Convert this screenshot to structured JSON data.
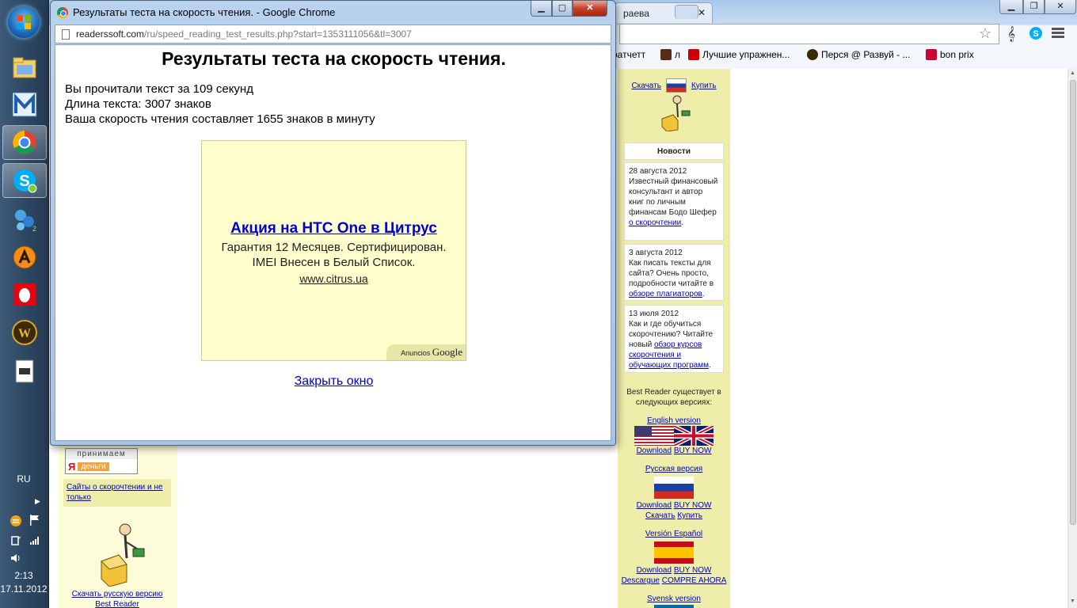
{
  "taskbar": {
    "icons": [
      "start-button",
      "file-manager-icon",
      "m-app-icon",
      "chrome-icon",
      "skype-icon",
      "molecule-app-icon",
      "aimp-icon",
      "mts-icon",
      "warcraft-icon",
      "document-icon"
    ],
    "language": "RU",
    "time": "2:13",
    "date": "17.11.2012"
  },
  "main_window": {
    "tab_fragment": "раева",
    "bookmarks": [
      "ратчетт",
      "л",
      "Лучшие упражнен...",
      "Перся @ Развуй - ...",
      "bon prix"
    ],
    "bookmark_colors": [
      "#5a2b17",
      "#8b1a1a",
      "#cc0000",
      "#333333",
      "#cc0033"
    ]
  },
  "popup": {
    "title": "Результаты теста на скорость чтения. - Google Chrome",
    "url_domain": "readerssoft.com",
    "url_path": "/ru/speed_reading_test_results.php?start=1353111056&tl=3007",
    "heading": "Результаты теста на скорость чтения.",
    "lines": [
      "Вы прочитали текст за 109 секунд",
      "Длина текста: 3007 знаков",
      "Ваша скорость чтения составляет 1655 знаков в минуту"
    ],
    "ad": {
      "title": "Акция на HTC One в Цитрус",
      "line1": "Гарантия 12 Месяцев. Сертифицирован.",
      "line2": "IMEI Внесен в Белый Список.",
      "url": "www.citrus.ua",
      "badge_prefix": "Anuncios",
      "badge_brand": "Google"
    },
    "close_link": "Закрыть окно"
  },
  "page_left": {
    "accept_label": "принимаем",
    "money_label": "деньги",
    "link_box": "Сайты о скорочтении и не только",
    "bottom_link1": "Скачать русскую версию",
    "bottom_link2": "Best Reader"
  },
  "page_right": {
    "top_download": "Скачать",
    "top_buy": "Купить",
    "news_title": "Новости",
    "news": [
      {
        "date": "28 августа 2012",
        "text": "Известный финансовый консультант и автор книг по личным финансам Бодо Шефер",
        "link": "о скорочтении"
      },
      {
        "date": "3 августа 2012",
        "text": "Как писать тексты для сайта? Очень просто, подробности читайте в",
        "link": "обзоре плагиаторов"
      },
      {
        "date": "13 июля 2012",
        "text": "Как и где обучиться скорочтению? Читайте новый",
        "link": "обзор курсов скорочтения и обучающих программ"
      }
    ],
    "versions_intro": "Best Reader существует в следующих версиях:",
    "english_version": "English version",
    "download": "Download",
    "buy_now": "BUY NOW",
    "russian_version": "Русская версия",
    "skachat": "Скачать",
    "kupit": "Купить",
    "spanish_version": "Versión Español",
    "descargue": "Descargue",
    "compre_ahora": "COMPRE AHORA",
    "swedish_version": "Svensk version"
  }
}
